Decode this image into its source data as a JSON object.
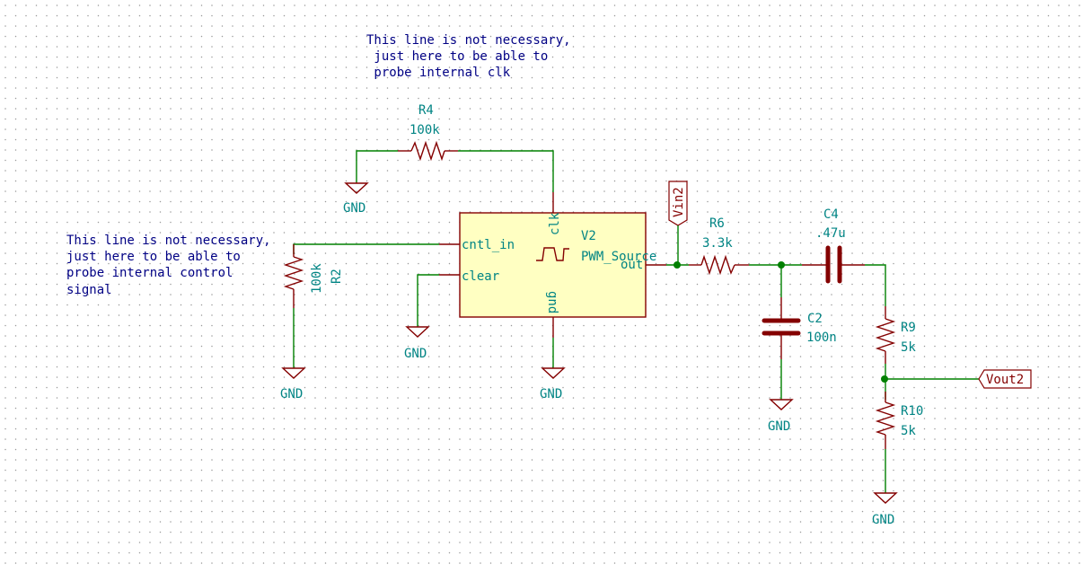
{
  "schematic": {
    "colors": {
      "wire": "#008000",
      "component": "#840000",
      "reference_text": "#008484",
      "note_text": "#000084",
      "ic_fill": "#ffffc2",
      "grid_dot": "#9a9a9a",
      "background": "#ffffff"
    },
    "notes": {
      "clk_note": [
        "This line is not necessary,",
        " just here to be able to",
        " probe internal clk"
      ],
      "cntl_note": [
        "This line is not necessary,",
        "just here to be able to",
        "probe internal control",
        "signal"
      ]
    },
    "components": {
      "R4": {
        "ref": "R4",
        "value": "100k"
      },
      "R2": {
        "ref": "R2",
        "value": "100k"
      },
      "V2": {
        "ref": "V2",
        "value": "PWM_Source",
        "pins": {
          "clk": "clk",
          "cntl_in": "cntl_in",
          "clear": "clear",
          "gnd": "gnd",
          "out": "out"
        }
      },
      "R6": {
        "ref": "R6",
        "value": "3.3k"
      },
      "C4": {
        "ref": "C4",
        "value": ".47u"
      },
      "C2": {
        "ref": "C2",
        "value": "100n"
      },
      "R9": {
        "ref": "R9",
        "value": "5k"
      },
      "R10": {
        "ref": "R10",
        "value": "5k"
      }
    },
    "power": {
      "gnd_label": "GND"
    },
    "net_labels": {
      "vin": "Vin2",
      "vout": "Vout2"
    }
  }
}
